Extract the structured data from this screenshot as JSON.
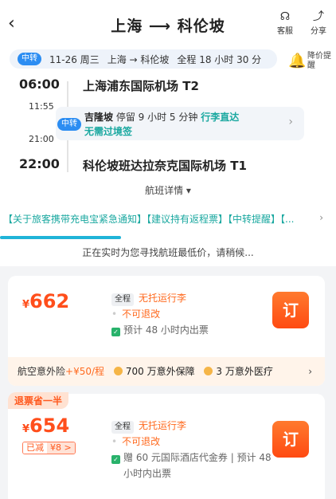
{
  "header": {
    "back_icon": "chevron-left-icon",
    "title": "上海 ⟶ 科伦坡",
    "service": {
      "icon": "headset-icon",
      "label": "客服"
    },
    "share": {
      "icon": "share-icon",
      "label": "分享"
    }
  },
  "info_bar": {
    "badge": "中转",
    "date": "11-26 周三",
    "route": "上海 → 科伦坡",
    "duration": "全程 18 小时 30 分"
  },
  "price_alert": {
    "icon": "bell-icon",
    "label": "降价提醒"
  },
  "itinerary": {
    "departure": {
      "time": "06:00",
      "airport": "上海浦东国际机场 T2"
    },
    "transfer": {
      "badge": "中转",
      "arrive_time": "11:55",
      "depart_time": "21:00",
      "city": "吉隆坡",
      "stay": "停留 9 小时 5 分钟",
      "luggage": "行李直达",
      "visa": "无需过境签"
    },
    "arrival": {
      "time": "22:00",
      "airport": "科伦坡班达拉奈克国际机场 T1"
    }
  },
  "flight_detail_label": "航班详情 ▾",
  "notice_text": "【关于旅客携带充电宝紧急通知】【建议持有返程票】【中转提醒】【...",
  "loading": {
    "progress": 0.36,
    "text": "正在实时为您寻找航班最低价，请稍候..."
  },
  "offers": [
    {
      "currency": "¥",
      "price": "662",
      "tag": "全程",
      "baggage": "无托运行李",
      "refund": "不可退改",
      "ticketing": "预计 48 小时内出票",
      "book_label": "订",
      "insurance": {
        "title": "航空意外险",
        "price": "+¥50/程",
        "benefit1": "700 万意外保障",
        "benefit2": "3 万意外医疗"
      }
    },
    {
      "promo_tag": "退票省一半",
      "currency": "¥",
      "price": "654",
      "discount_label": "已减",
      "discount_value": "¥8 >",
      "tag": "全程",
      "baggage": "无托运行李",
      "refund": "不可退改",
      "ticketing": "赠 60 元国际酒店代金券 | 预计 48",
      "ticketing_2": "小时内出票",
      "book_label": "订"
    }
  ],
  "colors": {
    "accent": "#ff4e1b",
    "teal": "#1aa8a0",
    "blue_badge": "#2c8df2"
  }
}
